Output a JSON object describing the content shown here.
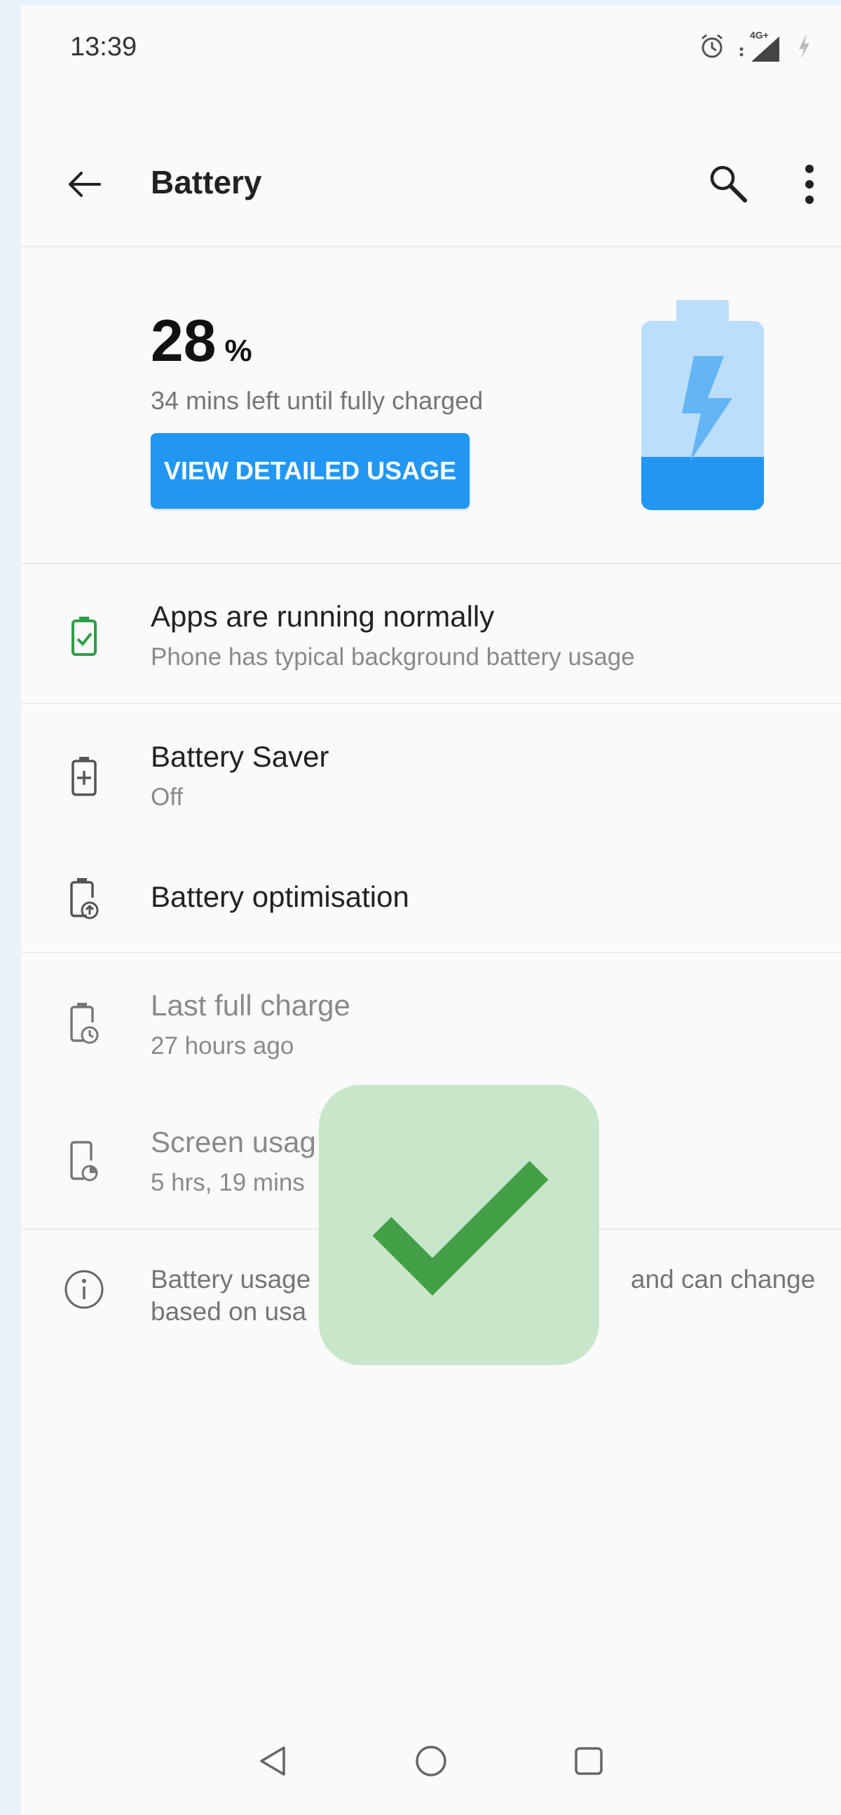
{
  "status_bar": {
    "time": "13:39",
    "network_label": "4G+",
    "icons": [
      "alarm-icon",
      "signal-icon",
      "charging-icon"
    ]
  },
  "toolbar": {
    "title": "Battery",
    "icons": [
      "back-arrow-icon",
      "search-icon",
      "more-vert-icon"
    ]
  },
  "summary": {
    "percent": "28",
    "percent_sign": "%",
    "level": 0.28,
    "time_left": "34 mins left until fully charged",
    "detail_button": "VIEW DETAILED USAGE",
    "icon": "battery-charging-icon"
  },
  "items": [
    {
      "title": "Apps are running normally",
      "subtitle": "Phone has typical background battery usage",
      "icon": "battery-check-icon"
    },
    {
      "title": "Battery Saver",
      "subtitle": "Off",
      "icon": "battery-plus-icon"
    },
    {
      "title": "Battery optimisation",
      "icon": "battery-optimise-icon"
    },
    {
      "title": "Last full charge",
      "subtitle": "27 hours ago",
      "icon": "battery-clock-icon"
    },
    {
      "title": "Screen usag",
      "subtitle": "5 hrs, 19 mins",
      "icon": "screen-usage-icon"
    }
  ],
  "info": {
    "line1_left": "Battery usage",
    "line1_right": "and can change",
    "line2_left": "based on usa",
    "icon": "info-icon"
  },
  "overlay": {
    "icon": "checkmark-icon"
  },
  "nav": [
    "back-triangle-icon",
    "home-circle-icon",
    "recents-square-icon"
  ],
  "colors": {
    "accent": "#2196f3",
    "battery_fill": "#2196f3",
    "battery_empty": "#bbdefb",
    "success_green": "#43a047",
    "overlay_bg": "#c8e6c9"
  }
}
